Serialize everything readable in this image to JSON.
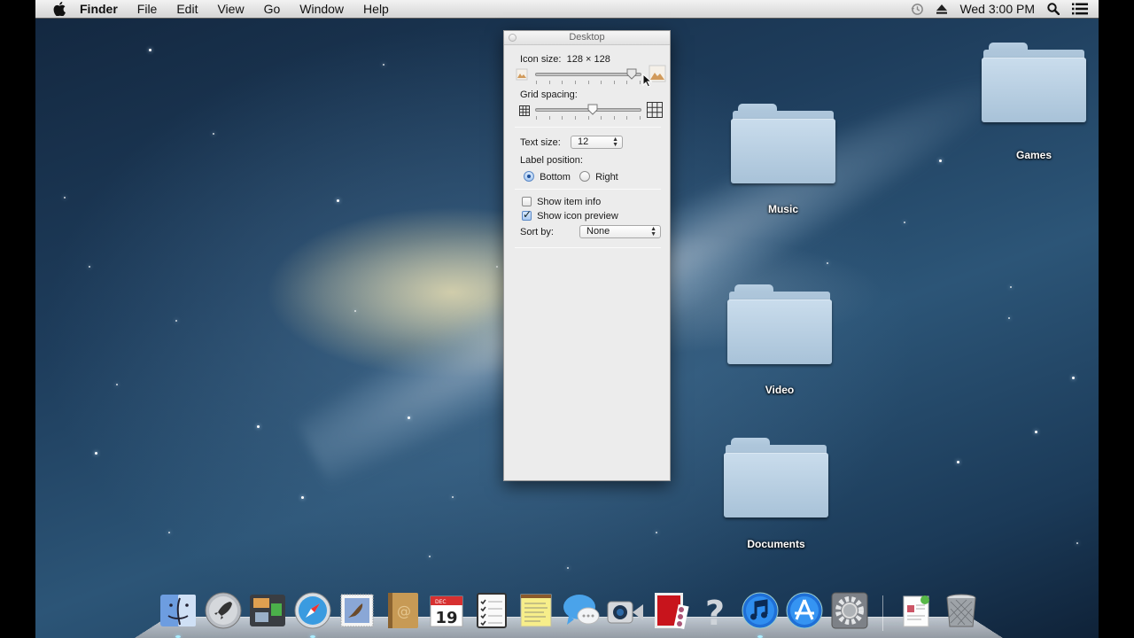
{
  "menubar": {
    "apple_icon": "apple-logo-icon",
    "app_name": "Finder",
    "menus": [
      "File",
      "Edit",
      "View",
      "Go",
      "Window",
      "Help"
    ],
    "status": {
      "time_machine_icon": "time-machine-icon",
      "eject_icon": "eject-icon",
      "clock": "Wed 3:00 PM",
      "spotlight_icon": "search-icon",
      "notification_icon": "notification-center-icon"
    }
  },
  "view_options": {
    "title": "Desktop",
    "icon_size_label": "Icon size:",
    "icon_size_value": "128 × 128",
    "icon_size_slider_percent": 94,
    "grid_spacing_label": "Grid spacing:",
    "grid_spacing_slider_percent": 54,
    "text_size_label": "Text size:",
    "text_size_value": "12",
    "label_position_label": "Label position:",
    "label_position_options": [
      {
        "label": "Bottom",
        "selected": true
      },
      {
        "label": "Right",
        "selected": false
      }
    ],
    "show_item_info": {
      "label": "Show item info",
      "checked": false
    },
    "show_icon_preview": {
      "label": "Show icon preview",
      "checked": true
    },
    "sort_by_label": "Sort by:",
    "sort_by_value": "None"
  },
  "desktop_items": [
    {
      "name": "Games"
    },
    {
      "name": "Music"
    },
    {
      "name": "Video"
    },
    {
      "name": "Documents"
    }
  ],
  "dock": {
    "apps": [
      {
        "name": "Finder",
        "icon": "finder-icon",
        "running": true
      },
      {
        "name": "Launchpad",
        "icon": "launchpad-icon",
        "running": false
      },
      {
        "name": "Mission Control",
        "icon": "mission-control-icon",
        "running": false
      },
      {
        "name": "Safari",
        "icon": "safari-icon",
        "running": true
      },
      {
        "name": "Mail",
        "icon": "mail-icon",
        "running": false
      },
      {
        "name": "Contacts",
        "icon": "contacts-icon",
        "running": false
      },
      {
        "name": "Calendar",
        "icon": "calendar-icon",
        "running": false,
        "badge_month": "DEC",
        "badge_day": "19"
      },
      {
        "name": "Reminders",
        "icon": "reminders-icon",
        "running": false
      },
      {
        "name": "Notes",
        "icon": "notes-icon",
        "running": false
      },
      {
        "name": "Messages",
        "icon": "messages-icon",
        "running": false
      },
      {
        "name": "FaceTime",
        "icon": "facetime-icon",
        "running": false
      },
      {
        "name": "Photo Booth",
        "icon": "photo-booth-icon",
        "running": false
      },
      {
        "name": "Help",
        "icon": "question-mark-icon",
        "running": false
      },
      {
        "name": "iTunes",
        "icon": "itunes-icon",
        "running": true
      },
      {
        "name": "App Store",
        "icon": "app-store-icon",
        "running": false
      },
      {
        "name": "System Preferences",
        "icon": "system-preferences-icon",
        "running": false
      }
    ],
    "stacks": [
      {
        "name": "Documents",
        "icon": "documents-stack-icon"
      },
      {
        "name": "Trash",
        "icon": "trash-icon"
      }
    ]
  }
}
